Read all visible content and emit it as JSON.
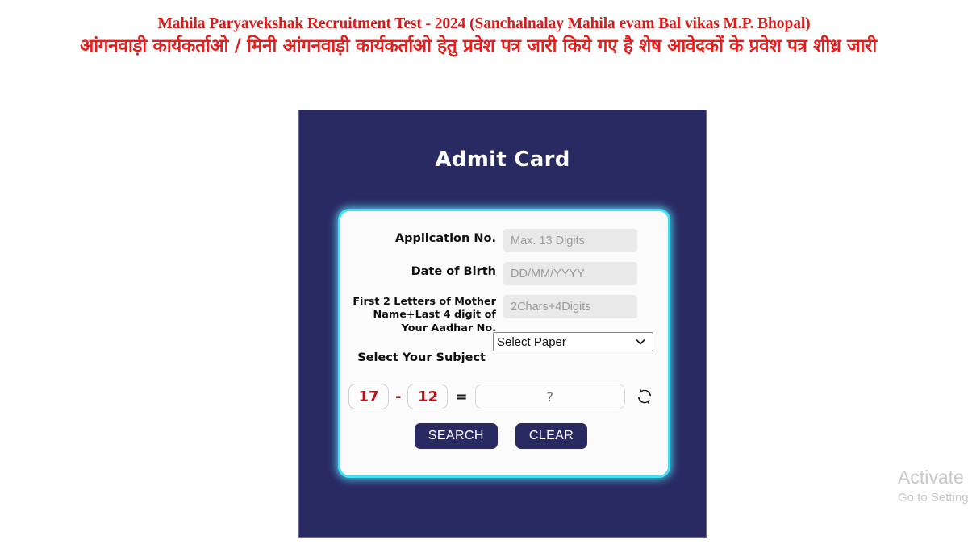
{
  "header": {
    "line_en": "Mahila Paryavekshak Recruitment Test - 2024 (Sanchalnalay Mahila evam Bal vikas M.P. Bhopal)",
    "line_hi": "आंगनवाड़ी कार्यकर्ताओ / मिनी आंगनवाड़ी कार्यकर्ताओ हेतु प्रवेश पत्र जारी किये गए है शेष आवेदकों के प्रवेश पत्र शीध्र जारी",
    "accent_color": "#d81c1c"
  },
  "panel": {
    "title": "Admit Card",
    "background_color": "#2a2a63",
    "card_border_color": "#43dff3"
  },
  "form": {
    "fields": [
      {
        "label": "Application No.",
        "placeholder": "Max. 13 Digits",
        "value": "",
        "name": "application-no"
      },
      {
        "label": "Date of Birth",
        "placeholder": "DD/MM/YYYY",
        "value": "",
        "name": "date-of-birth"
      },
      {
        "label": "First 2 Letters of Mother Name+Last 4 digit of Your Aadhar No.",
        "placeholder": "2Chars+4Digits",
        "value": "",
        "name": "mother-aadhar"
      }
    ],
    "subject": {
      "label": "Select Your Subject",
      "selected": "Select Paper",
      "options": [
        "Select Paper"
      ]
    }
  },
  "captcha": {
    "operand_a": "17",
    "operator": "-",
    "operand_b": "12",
    "equals": "=",
    "answer_placeholder": "?",
    "answer_value": "",
    "number_color": "#b8121a",
    "refresh_icon": "refresh-icon"
  },
  "buttons": {
    "search": "SEARCH",
    "clear": "CLEAR"
  },
  "watermark": {
    "title": "Activate Windows",
    "subtitle": "Go to Settings to activate Windows."
  }
}
